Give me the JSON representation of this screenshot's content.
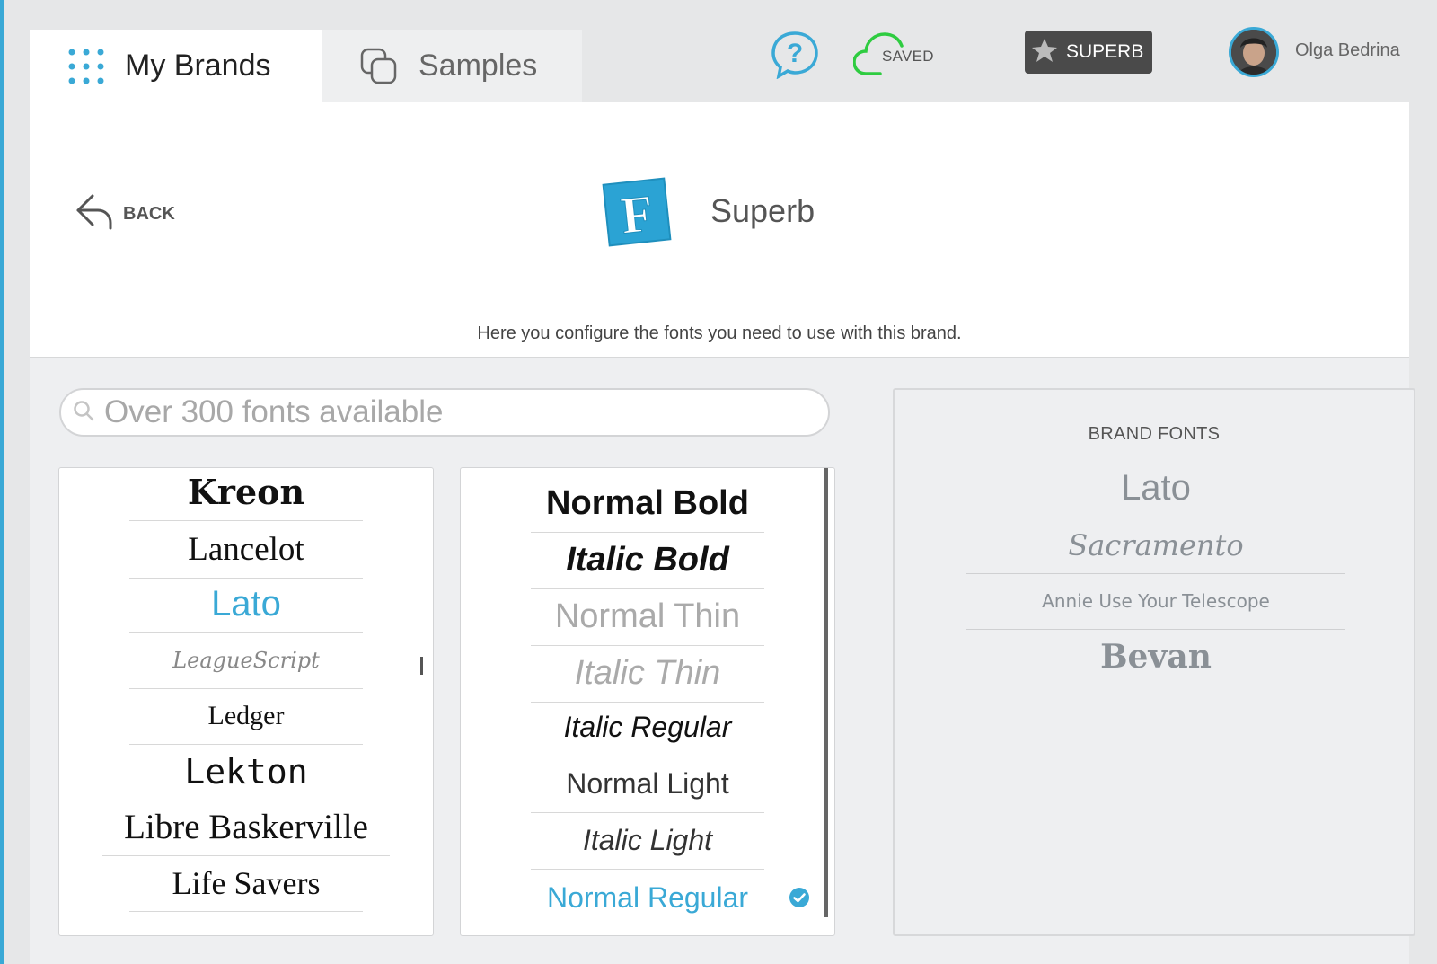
{
  "nav": {
    "tabs": [
      {
        "label": "My Brands",
        "active": true,
        "icon": "grid-dots-icon"
      },
      {
        "label": "Samples",
        "active": false,
        "icon": "copy-icon"
      }
    ],
    "saved_label": "SAVED",
    "plan_label": "SUPERB",
    "user_name": "Olga Bedrina"
  },
  "header": {
    "back_label": "BACK",
    "brand_logo_letter": "F",
    "brand_name": "Superb",
    "description": "Here you configure the fonts you need to use with this brand."
  },
  "search": {
    "placeholder": "Over 300 fonts available",
    "value": ""
  },
  "font_families": [
    {
      "label": "Kreon",
      "selected": false
    },
    {
      "label": "Lancelot",
      "selected": false
    },
    {
      "label": "Lato",
      "selected": true
    },
    {
      "label": "LeagueScript",
      "selected": false
    },
    {
      "label": "Ledger",
      "selected": false
    },
    {
      "label": "Lekton",
      "selected": false
    },
    {
      "label": "Libre Baskerville",
      "selected": false
    },
    {
      "label": "Life Savers",
      "selected": false
    }
  ],
  "font_styles": [
    {
      "label": "Normal Bold",
      "selected": false
    },
    {
      "label": "Italic Bold",
      "selected": false
    },
    {
      "label": "Normal Thin",
      "selected": false
    },
    {
      "label": "Italic Thin",
      "selected": false
    },
    {
      "label": "Italic Regular",
      "selected": false
    },
    {
      "label": "Normal Light",
      "selected": false
    },
    {
      "label": "Italic Light",
      "selected": false
    },
    {
      "label": "Normal Regular",
      "selected": true
    }
  ],
  "brand_fonts": {
    "title": "BRAND FONTS",
    "items": [
      "Lato",
      "Sacramento",
      "Annie Use Your Telescope",
      "Bevan"
    ]
  },
  "colors": {
    "accent": "#3aa9d6",
    "saved_cloud": "#2ecc40",
    "badge_bg": "#4a4a4a"
  }
}
